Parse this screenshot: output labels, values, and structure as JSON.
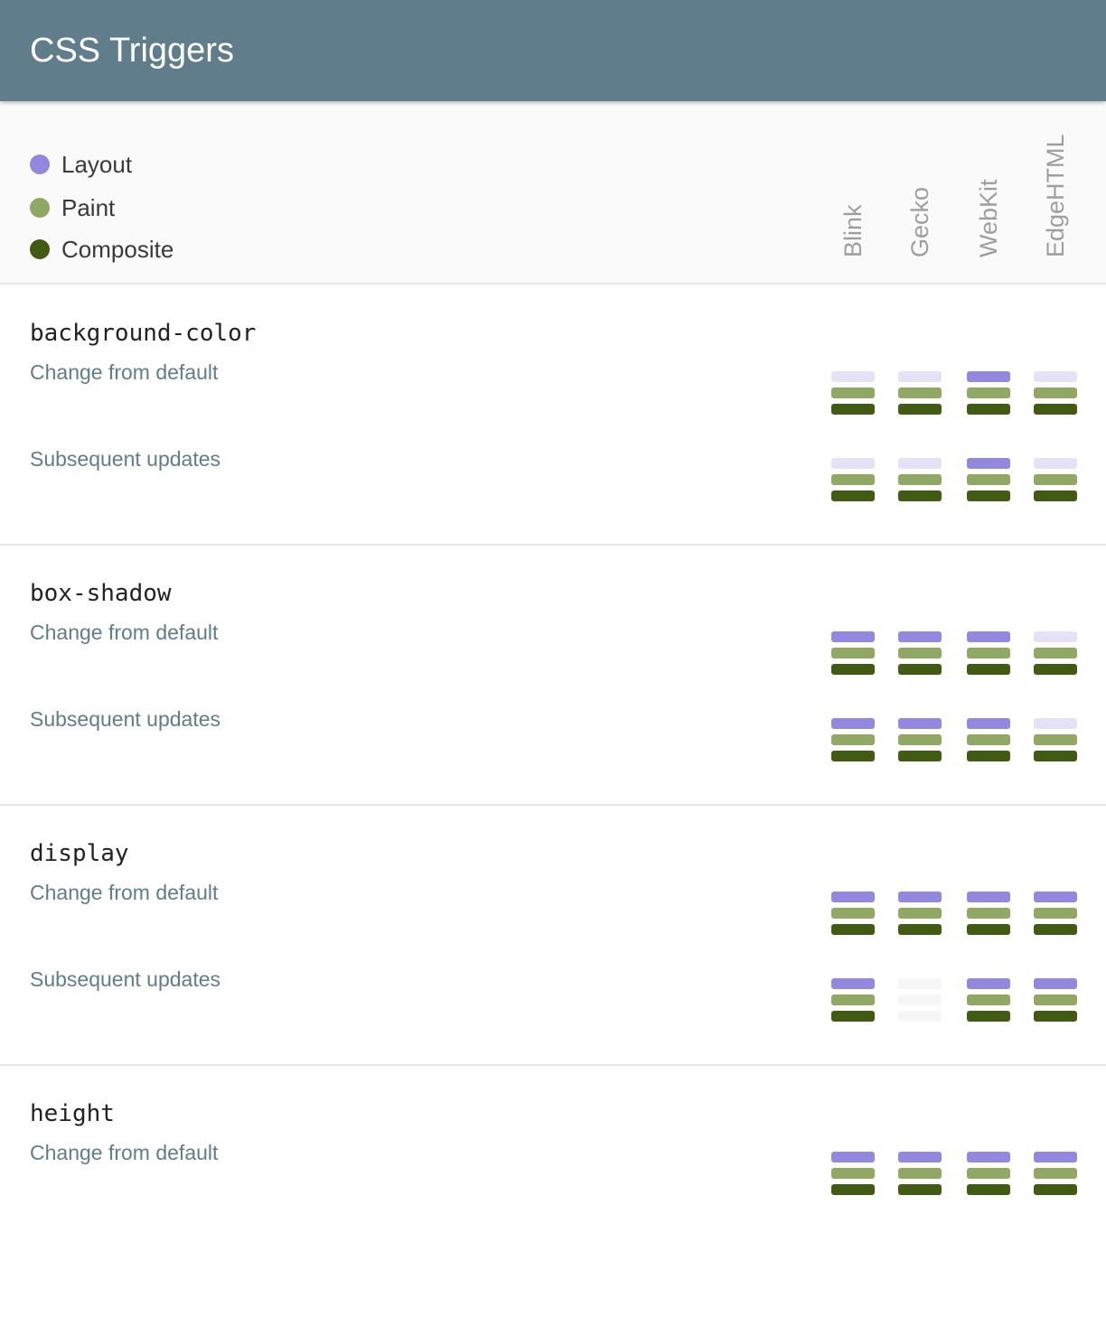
{
  "app": {
    "title": "CSS Triggers"
  },
  "legend": [
    {
      "key": "layout",
      "label": "Layout",
      "color": "#9388e0"
    },
    {
      "key": "paint",
      "label": "Paint",
      "color": "#8fa864"
    },
    {
      "key": "composite",
      "label": "Composite",
      "color": "#425b12"
    }
  ],
  "inactive_colors": {
    "layout": "#e5e2f7",
    "missing": "#f6f6f6"
  },
  "engines": [
    "Blink",
    "Gecko",
    "WebKit",
    "EdgeHTML"
  ],
  "properties": [
    {
      "name": "background-color",
      "rows": [
        {
          "label": "Change from default",
          "triggers": [
            {
              "layout": false,
              "paint": true,
              "composite": true
            },
            {
              "layout": false,
              "paint": true,
              "composite": true
            },
            {
              "layout": true,
              "paint": true,
              "composite": true
            },
            {
              "layout": false,
              "paint": true,
              "composite": true
            }
          ]
        },
        {
          "label": "Subsequent updates",
          "triggers": [
            {
              "layout": false,
              "paint": true,
              "composite": true
            },
            {
              "layout": false,
              "paint": true,
              "composite": true
            },
            {
              "layout": true,
              "paint": true,
              "composite": true
            },
            {
              "layout": false,
              "paint": true,
              "composite": true
            }
          ]
        }
      ]
    },
    {
      "name": "box-shadow",
      "rows": [
        {
          "label": "Change from default",
          "triggers": [
            {
              "layout": true,
              "paint": true,
              "composite": true
            },
            {
              "layout": true,
              "paint": true,
              "composite": true
            },
            {
              "layout": true,
              "paint": true,
              "composite": true
            },
            {
              "layout": false,
              "paint": true,
              "composite": true
            }
          ]
        },
        {
          "label": "Subsequent updates",
          "triggers": [
            {
              "layout": true,
              "paint": true,
              "composite": true
            },
            {
              "layout": true,
              "paint": true,
              "composite": true
            },
            {
              "layout": true,
              "paint": true,
              "composite": true
            },
            {
              "layout": false,
              "paint": true,
              "composite": true
            }
          ]
        }
      ]
    },
    {
      "name": "display",
      "rows": [
        {
          "label": "Change from default",
          "triggers": [
            {
              "layout": true,
              "paint": true,
              "composite": true
            },
            {
              "layout": true,
              "paint": true,
              "composite": true
            },
            {
              "layout": true,
              "paint": true,
              "composite": true
            },
            {
              "layout": true,
              "paint": true,
              "composite": true
            }
          ]
        },
        {
          "label": "Subsequent updates",
          "triggers": [
            {
              "layout": true,
              "paint": true,
              "composite": true
            },
            {
              "missing": true
            },
            {
              "layout": true,
              "paint": true,
              "composite": true
            },
            {
              "layout": true,
              "paint": true,
              "composite": true
            }
          ]
        }
      ]
    },
    {
      "name": "height",
      "rows": [
        {
          "label": "Change from default",
          "triggers": [
            {
              "layout": true,
              "paint": true,
              "composite": true
            },
            {
              "layout": true,
              "paint": true,
              "composite": true
            },
            {
              "layout": true,
              "paint": true,
              "composite": true
            },
            {
              "layout": true,
              "paint": true,
              "composite": true
            }
          ]
        }
      ]
    }
  ]
}
